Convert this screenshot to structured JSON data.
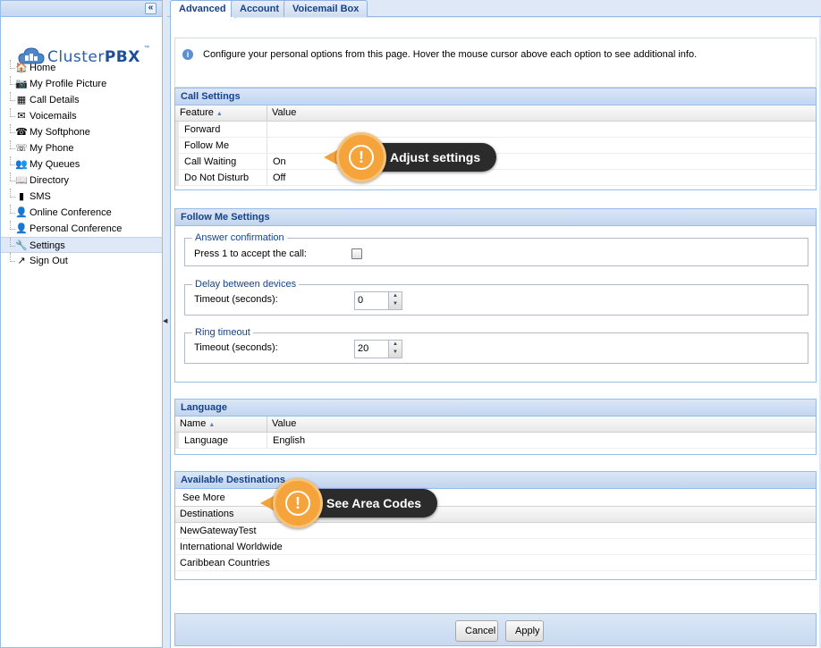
{
  "sidebar": {
    "collapse_icon": "«",
    "logo": {
      "text_light": "Cluster",
      "text_bold": "PBX",
      "tm": "™"
    },
    "items": [
      {
        "label": "Home",
        "icon": "🏠",
        "active": false
      },
      {
        "label": "My Profile Picture",
        "icon": "📷",
        "active": false
      },
      {
        "label": "Call Details",
        "icon": "▦",
        "active": false
      },
      {
        "label": "Voicemails",
        "icon": "✉",
        "active": false
      },
      {
        "label": "My Softphone",
        "icon": "☎",
        "active": false
      },
      {
        "label": "My Phone",
        "icon": "☏",
        "active": false
      },
      {
        "label": "My Queues",
        "icon": "👥",
        "active": false
      },
      {
        "label": "Directory",
        "icon": "📖",
        "active": false
      },
      {
        "label": "SMS",
        "icon": "▮",
        "active": false
      },
      {
        "label": "Online Conference",
        "icon": "👤",
        "active": false
      },
      {
        "label": "Personal Conference",
        "icon": "👤",
        "active": false
      },
      {
        "label": "Settings",
        "icon": "🔧",
        "active": true
      },
      {
        "label": "Sign Out",
        "icon": "↗",
        "active": false
      }
    ]
  },
  "tabs": [
    "Advanced",
    "Account",
    "Voicemail Box"
  ],
  "info": {
    "icon": "i",
    "text": "Configure your personal options from this page. Hover the mouse cursor above each option to see additional info."
  },
  "call_settings": {
    "title": "Call Settings",
    "col_feature": "Feature",
    "col_value": "Value",
    "rows": [
      {
        "feature": "Forward",
        "value": ""
      },
      {
        "feature": "Follow Me",
        "value": ""
      },
      {
        "feature": "Call Waiting",
        "value": "On"
      },
      {
        "feature": "Do Not Disturb",
        "value": "Off"
      }
    ]
  },
  "follow_me": {
    "title": "Follow Me Settings",
    "answer_legend": "Answer confirmation",
    "answer_label": "Press 1 to accept the call:",
    "delay_legend": "Delay between devices",
    "delay_label": "Timeout (seconds):",
    "delay_value": "0",
    "ring_legend": "Ring timeout",
    "ring_label": "Timeout (seconds):",
    "ring_value": "20"
  },
  "language": {
    "title": "Language",
    "col_name": "Name",
    "col_value": "Value",
    "row_name": "Language",
    "row_value": "English"
  },
  "destinations": {
    "title": "Available Destinations",
    "see_more": "See More",
    "header": "Destinations",
    "items": [
      "NewGatewayTest",
      "International Worldwide",
      "Caribbean Countries"
    ]
  },
  "buttons": {
    "cancel": "Cancel",
    "apply": "Apply"
  },
  "callouts": {
    "adjust": "Adjust settings",
    "area_codes": "See Area Codes",
    "mark": "!"
  },
  "colors": {
    "header_text": "#15428b",
    "callout_orange": "#f4a43a",
    "callout_dark": "#2b2b2b"
  }
}
